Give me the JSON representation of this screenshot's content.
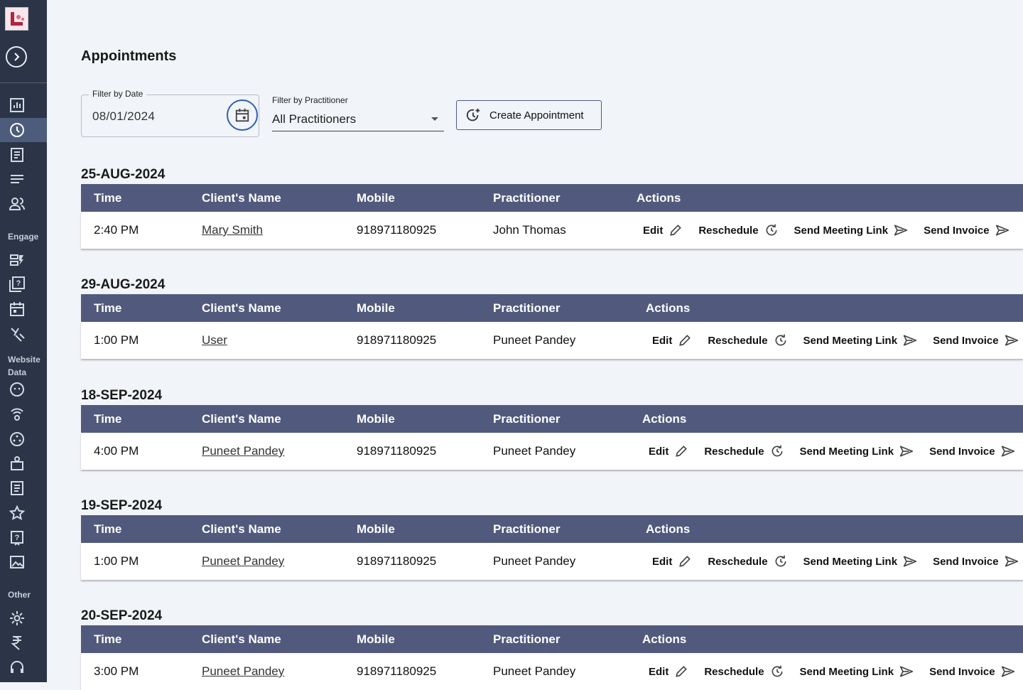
{
  "page": {
    "title": "Appointments"
  },
  "sidebar": {
    "sections": [
      "Engage",
      "Website",
      "Data",
      "Other"
    ]
  },
  "filters": {
    "date_label": "Filter by Date",
    "date_value": "08/01/2024",
    "practitioner_label": "Filter by Practitioner",
    "practitioner_value": "All Practitioners",
    "create_button": "Create Appointment"
  },
  "table": {
    "headers": [
      "Time",
      "Client's Name",
      "Mobile",
      "Practitioner",
      "Actions"
    ],
    "actions": [
      "Edit",
      "Reschedule",
      "Send Meeting Link",
      "Send Invoice"
    ]
  },
  "groups": [
    {
      "date": "25-AUG-2024",
      "time": "2:40 PM",
      "client": "Mary Smith",
      "mobile": "918971180925",
      "practitioner": "John Thomas"
    },
    {
      "date": "29-AUG-2024",
      "time": "1:00 PM",
      "client": "User",
      "mobile": "918971180925",
      "practitioner": "Puneet Pandey"
    },
    {
      "date": "18-SEP-2024",
      "time": "4:00 PM",
      "client": "Puneet Pandey",
      "mobile": "918971180925",
      "practitioner": "Puneet Pandey"
    },
    {
      "date": "19-SEP-2024",
      "time": "1:00 PM",
      "client": "Puneet Pandey",
      "mobile": "918971180925",
      "practitioner": "Puneet Pandey"
    },
    {
      "date": "20-SEP-2024",
      "time": "3:00 PM",
      "client": "Puneet Pandey",
      "mobile": "918971180925",
      "practitioner": "Puneet Pandey"
    }
  ]
}
